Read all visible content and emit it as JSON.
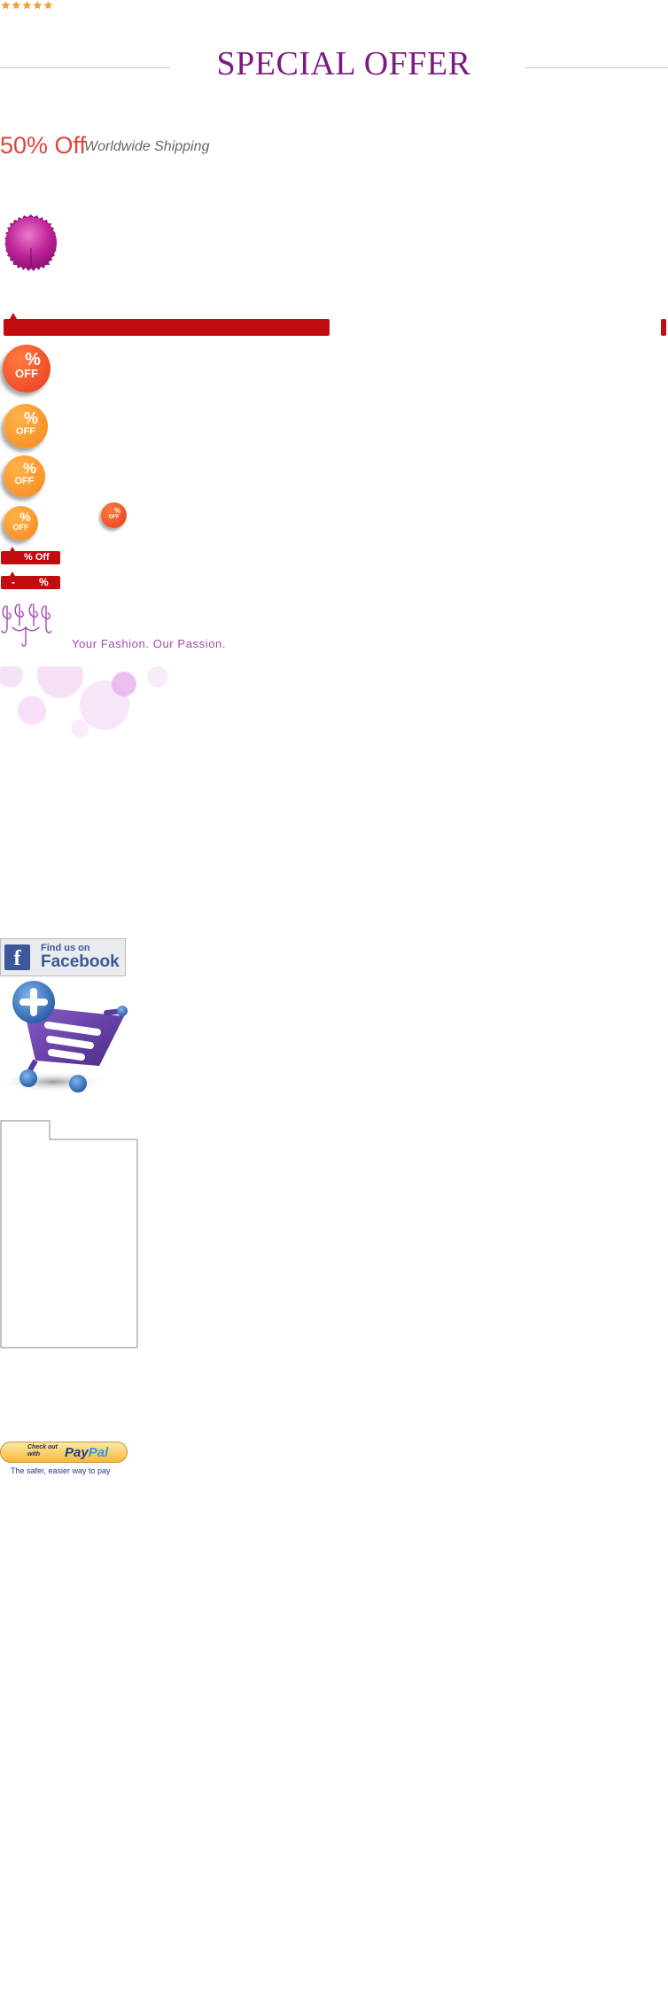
{
  "rating": {
    "stars": 5
  },
  "special_offer": {
    "title": "SPECIAL OFFER"
  },
  "discount": {
    "headline": "50% Off",
    "shipping": "Worldwide Shipping"
  },
  "badges": {
    "pct": "%",
    "off": "OFF"
  },
  "tags": {
    "percent_off": "% Off",
    "minus": "-",
    "percent": "%"
  },
  "tagline": "Your Fashion. Our Passion.",
  "facebook": {
    "line1": "Find us on",
    "line2": "Facebook"
  },
  "paypal": {
    "checkout": "Check out with",
    "logo_a": "Pay",
    "logo_b": "Pal",
    "tagline": "The safer, easier way to pay"
  },
  "colors": {
    "accent_purple": "#7b1b80",
    "ribbon_red": "#c10d10",
    "offer_red": "#e0443c",
    "badge_orange": "#f7931e",
    "badge_red": "#f0532a"
  }
}
